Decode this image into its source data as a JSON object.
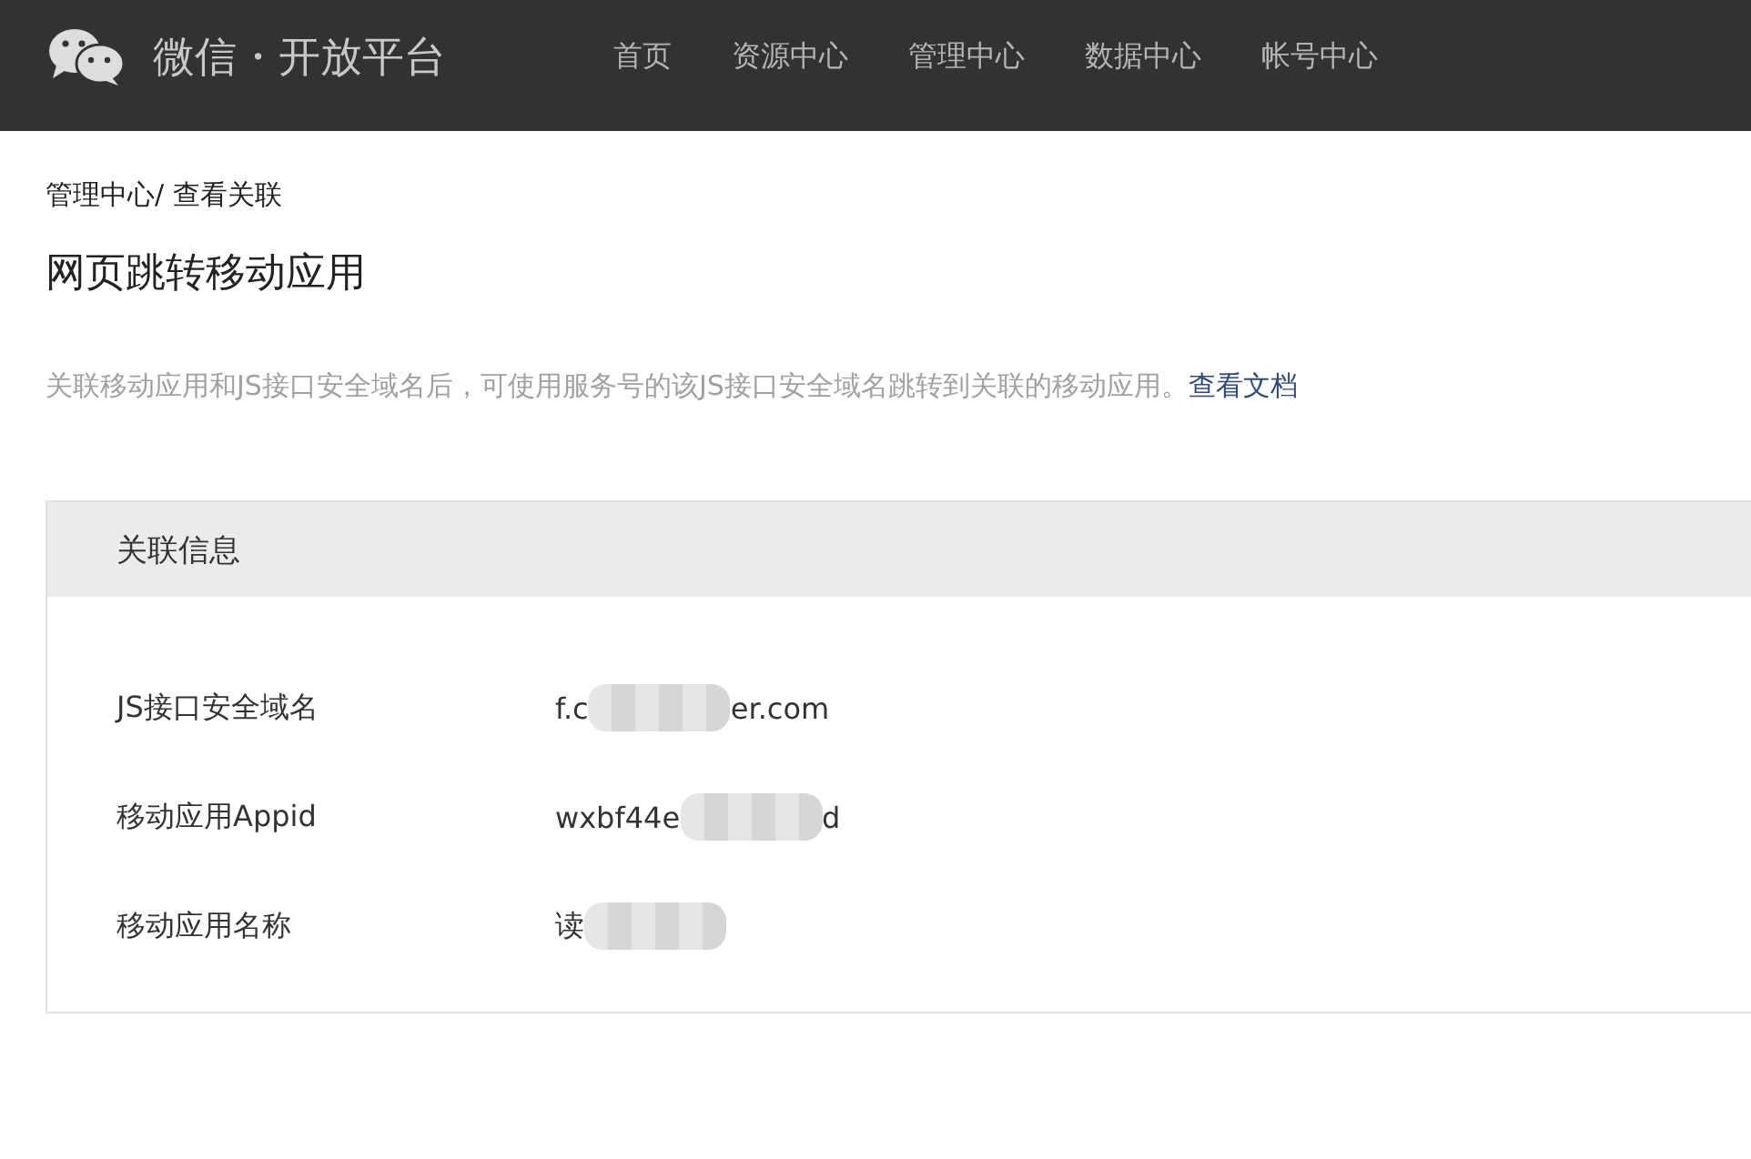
{
  "header": {
    "brand": "微信・开放平台",
    "nav": [
      {
        "label": "首页",
        "selected": false
      },
      {
        "label": "资源中心",
        "selected": false
      },
      {
        "label": "管理中心",
        "selected": false
      },
      {
        "label": "数据中心",
        "selected": false
      },
      {
        "label": "帐号中心",
        "selected": false
      }
    ]
  },
  "breadcrumb": "管理中心/ 查看关联",
  "title": "网页跳转移动应用",
  "description": {
    "text": "关联移动应用和JS接口安全域名后，可使用服务号的该JS接口安全域名跳转到关联的移动应用。",
    "link": "查看文档"
  },
  "panel": {
    "title": "关联信息",
    "rows": [
      {
        "label": "JS接口安全域名",
        "value_start": "f.c",
        "value_end": "er.com",
        "redacted": true
      },
      {
        "label": "移动应用Appid",
        "value_start": "wxbf44e",
        "value_end": "d",
        "redacted": true
      },
      {
        "label": "移动应用名称",
        "value_start": "读",
        "redacted": true
      }
    ]
  }
}
